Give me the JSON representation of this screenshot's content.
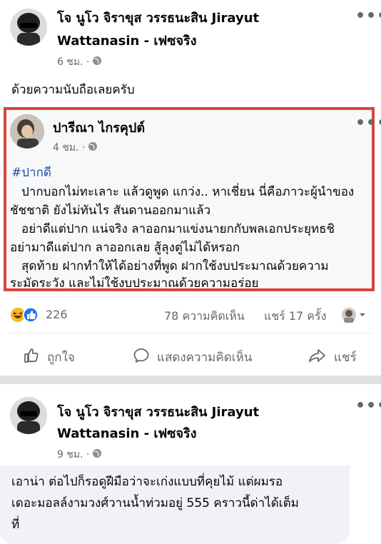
{
  "post": {
    "author": "โจ นูโว จิราขุส วรรธนะสิน Jirayut",
    "author_line2": "Wattanasin - เฟซจริง",
    "time": "6 ชม. ·",
    "text": "ด้วยความนับถือเลยครับ",
    "more": "•••"
  },
  "shared": {
    "author": "ปารีณา ไกรคุปต์",
    "time": "4 ชม. ·",
    "hashtag": "#ปากดี",
    "more": "•••",
    "lines": [
      "ปากบอกไม่ทะเลาะ  แล้วดูพูด แกว่ง..  หาเชี่ยน นี่คือภาวะผู้นำของ",
      "ชัชชาติ ยังไม่ทันไร สันดานออกมาแล้ว",
      "อย่าดีแต่ปาก  แน่จริง ลาออกมาแข่งนายกกับพลเอกประยุทธชิ",
      "อย่ามาดีแต่ปาก ลาออกเลย สู้ลุงตู่ไม่ได้หรอก",
      "สุดท้าย ฝากทำให้ได้อย่างที่พูด  ฝากใช้งบประมาณด้วยความ",
      "ระมัดระวัง และไม่ใช้งบประมาณด้วยความอร่อย"
    ]
  },
  "stats": {
    "reactions": "226",
    "comments": "78 ความคิดเห็น",
    "shares": "แชร์ 17 ครั้ง"
  },
  "actions": {
    "like": "ถูกใจ",
    "comment": "แสดงความคิดเห็น",
    "share": "แชร์"
  },
  "comment": {
    "author": "โจ นูโว จิราขุส วรรธนะสิน Jirayut",
    "author_line2": "Wattanasin - เฟซจริง",
    "time": "9 ชม. ·",
    "more": "•••",
    "lines": [
      "เอาน่า ต่อไปก็รอดูฝีมือว่าจะเก่งแบบที่คุยไม้ แต่ผมรอ",
      "เดอะมอลล์งามวงศ์วานน้ำท่วมอยู่ 555 คราวนี้ด่าได้เต็ม",
      "ที่"
    ]
  },
  "colors": {
    "highlight_border": "#d9443b",
    "hashtag": "#1b4fa3",
    "like_blue": "#1877f2",
    "haha_yellow": "#f7b928"
  },
  "icons": [
    "globe-icon",
    "more-icon",
    "haha-icon",
    "like-reaction-icon",
    "like-icon",
    "comment-icon",
    "share-icon",
    "chevron-down-icon"
  ]
}
